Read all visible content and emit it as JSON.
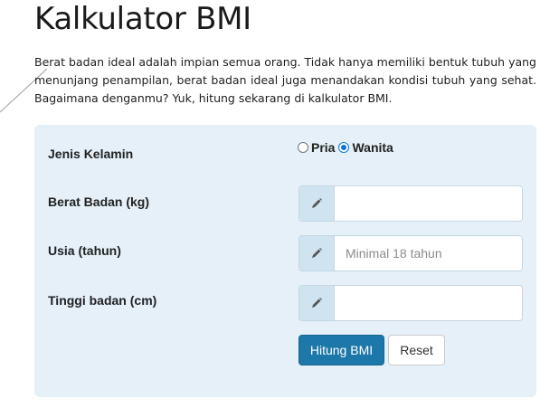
{
  "page": {
    "title": "Kalkulator BMI",
    "intro": "Berat badan ideal adalah impian semua orang. Tidak hanya memiliki bentuk tubuh yang menunjang penampilan, berat badan ideal juga menandakan kondisi tubuh yang sehat. Bagaimana denganmu? Yuk, hitung sekarang di kalkulator BMI."
  },
  "form": {
    "gender": {
      "label": "Jenis Kelamin",
      "options": [
        {
          "label": "Pria",
          "checked": false
        },
        {
          "label": "Wanita",
          "checked": true
        }
      ]
    },
    "weight": {
      "label": "Berat Badan (kg)",
      "value": "",
      "placeholder": "",
      "icon": "pencil-icon"
    },
    "age": {
      "label": "Usia (tahun)",
      "value": "",
      "placeholder": "Minimal 18 tahun",
      "icon": "pencil-icon"
    },
    "height": {
      "label": "Tinggi badan (cm)",
      "value": "",
      "placeholder": "",
      "icon": "pencil-icon"
    },
    "submit_label": "Hitung BMI",
    "reset_label": "Reset"
  },
  "colors": {
    "card_background": "#e5f0f8",
    "addon_background": "#cfe3f1",
    "primary_button": "#1c78a8",
    "radio_checked": "#0a74d6"
  }
}
